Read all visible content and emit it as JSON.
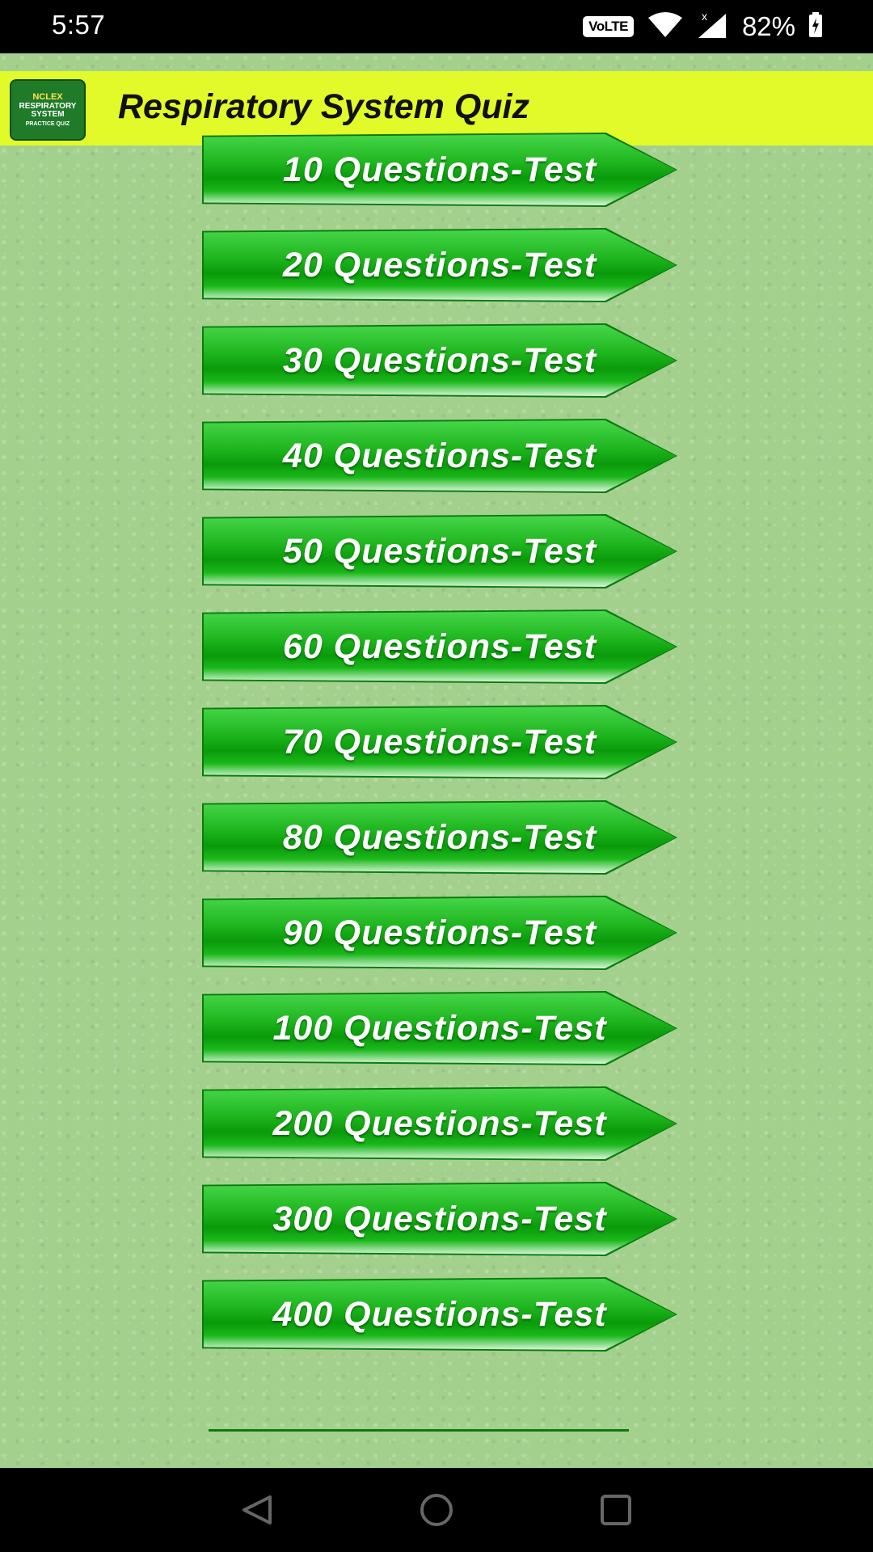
{
  "status_bar": {
    "time": "5:57",
    "network_badge": "VoLTE",
    "battery_percent": "82%",
    "icons": [
      "wifi-icon",
      "signal-icon",
      "battery-charging-icon"
    ]
  },
  "app_bar": {
    "logo_lines": [
      "NCLEX",
      "RESPIRATORY",
      "SYSTEM",
      "PRACTICE QUIZ"
    ],
    "title": "Respiratory System Quiz",
    "background_color": "#e2fa2a"
  },
  "tests": [
    {
      "label": "10 Questions-Test"
    },
    {
      "label": "20 Questions-Test"
    },
    {
      "label": "30 Questions-Test"
    },
    {
      "label": "40 Questions-Test"
    },
    {
      "label": "50 Questions-Test"
    },
    {
      "label": "60 Questions-Test"
    },
    {
      "label": "70 Questions-Test"
    },
    {
      "label": "80 Questions-Test"
    },
    {
      "label": "90 Questions-Test"
    },
    {
      "label": "100 Questions-Test"
    },
    {
      "label": "200 Questions-Test"
    },
    {
      "label": "300 Questions-Test"
    },
    {
      "label": "400 Questions-Test"
    }
  ],
  "colors": {
    "background": "#a4d08e",
    "button_green": "#1eb51e"
  },
  "nav_bar": {
    "icons": [
      "back-icon",
      "home-icon",
      "recents-icon"
    ]
  }
}
